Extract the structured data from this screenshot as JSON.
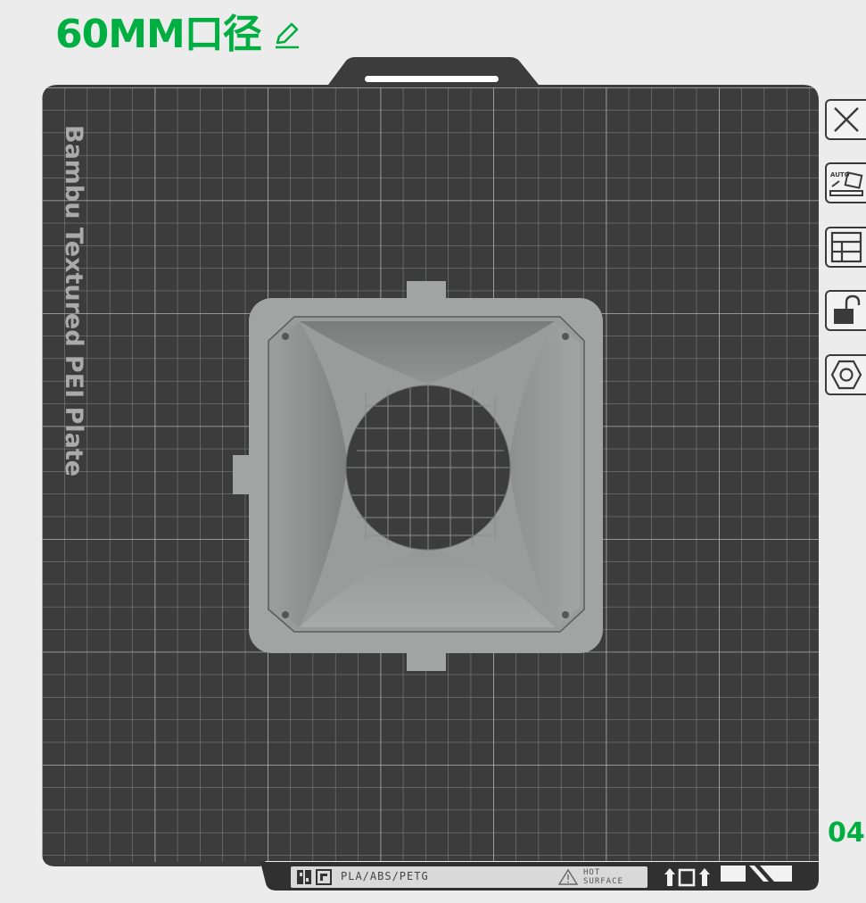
{
  "title": "60MM口径",
  "plate": {
    "label": "Bambu Textured PEI Plate",
    "number": "04",
    "filament_types": "PLA/ABS/PETG",
    "hot_surface": [
      "HOT",
      "SURFACE"
    ]
  },
  "colors": {
    "accent": "#00ae42",
    "plate": "#3b3c3b",
    "grid": "#8a8b8a",
    "model": "#8f9090",
    "background": "#ebeceb"
  },
  "toolbar": {
    "items": [
      {
        "name": "close",
        "icon": "close-icon"
      },
      {
        "name": "auto-orient",
        "icon": "auto-orient-icon"
      },
      {
        "name": "arrange",
        "icon": "arrange-icon"
      },
      {
        "name": "lock",
        "icon": "unlock-icon"
      },
      {
        "name": "plate-settings",
        "icon": "hex-nut-icon"
      }
    ]
  }
}
